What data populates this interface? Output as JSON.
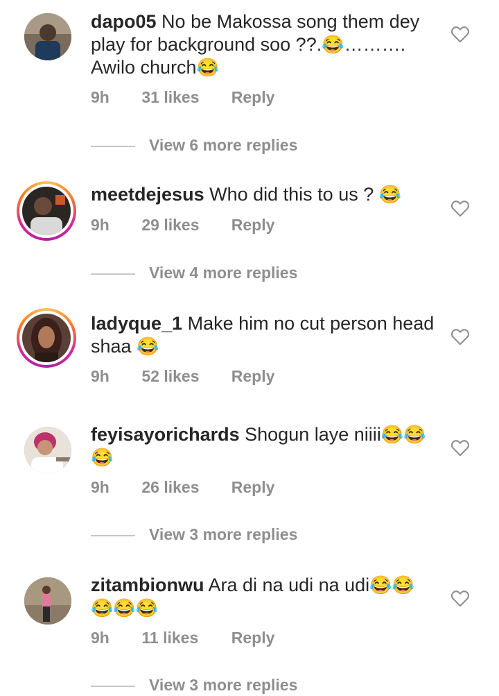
{
  "comments": [
    {
      "username": "dapo05",
      "text": "No be Makossa song them dey play for background soo ??.",
      "text_emoji_1": "😂",
      "text_tail": "………. Awilo church",
      "text_emoji_2": "😂",
      "time": "9h",
      "likes": "31 likes",
      "reply": "Reply",
      "view_replies": "View 6 more replies"
    },
    {
      "username": "meetdejesus",
      "text": "Who did this to us ?",
      "text_emoji_1": "😂",
      "time": "9h",
      "likes": "29 likes",
      "reply": "Reply",
      "view_replies": "View 4 more replies"
    },
    {
      "username": "ladyque_1",
      "text": "Make him no cut person head shaa",
      "text_emoji_1": "😂",
      "time": "9h",
      "likes": "52 likes",
      "reply": "Reply"
    },
    {
      "username": "feyisayorichards",
      "text": "Shogun laye niiii",
      "text_emoji_1": "😂😂",
      "text_emoji_2": "😂",
      "time": "9h",
      "likes": "26 likes",
      "reply": "Reply",
      "view_replies": "View 3 more replies"
    },
    {
      "username": "zitambionwu",
      "text": "Ara di na udi na udi",
      "text_emoji_1": "😂😂",
      "text_emoji_2": "😂😂😂",
      "time": "9h",
      "likes": "11 likes",
      "reply": "Reply",
      "view_replies": "View 3 more replies"
    }
  ],
  "icons": {
    "like": "heart-outline-icon"
  },
  "colors": {
    "secondary_text": "#8e8e8e",
    "primary_text": "#262626",
    "story_ring": "#d6249f"
  }
}
